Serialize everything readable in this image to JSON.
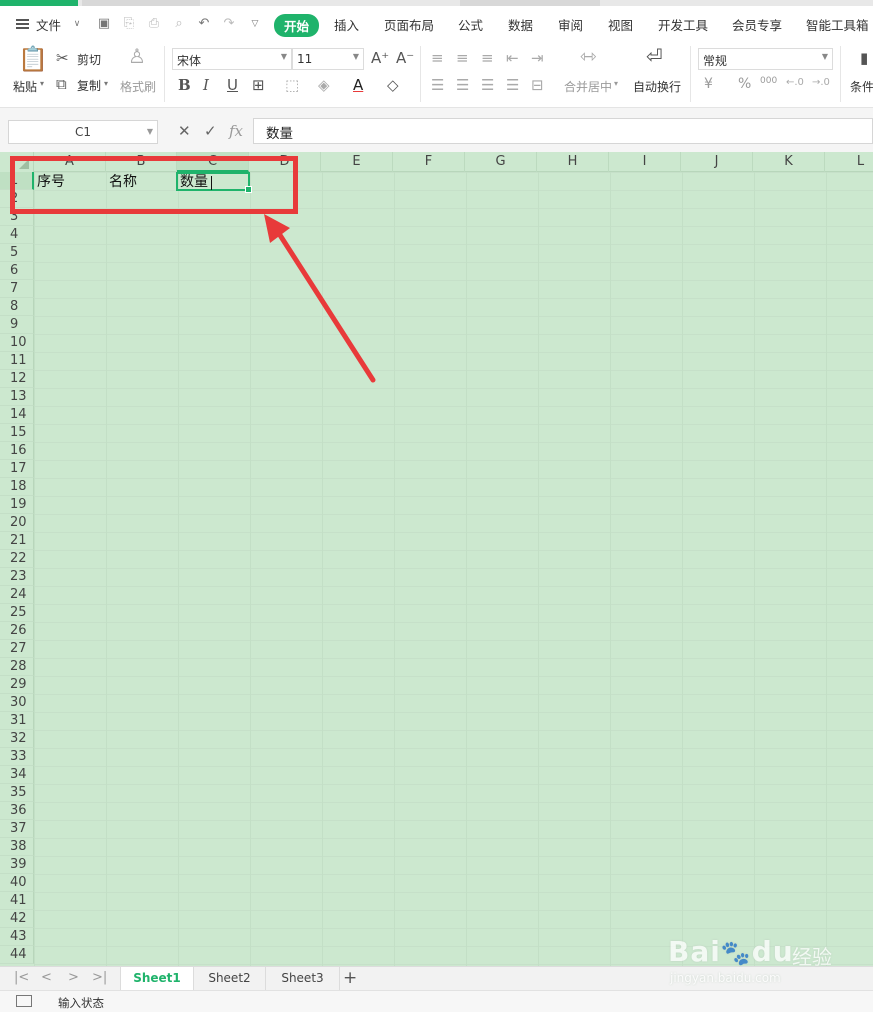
{
  "menu": {
    "file": "文件",
    "tabs": [
      "开始",
      "插入",
      "页面布局",
      "公式",
      "数据",
      "审阅",
      "视图",
      "开发工具",
      "会员专享",
      "智能工具箱"
    ]
  },
  "ribbon": {
    "paste": "粘贴",
    "cut": "剪切",
    "copy": "复制",
    "format_painter": "格式刷",
    "font_name": "宋体",
    "font_size": "11",
    "merge_center": "合并居中",
    "wrap_text": "自动换行",
    "number_format": "常规",
    "currency_symbol": "¥",
    "percent_symbol": "%",
    "thousands": "000",
    "conditional": "条件"
  },
  "formula_bar": {
    "name_box": "C1",
    "content": "数量",
    "fx": "fx"
  },
  "grid": {
    "columns": [
      "A",
      "B",
      "C",
      "D",
      "E",
      "F",
      "G",
      "H",
      "I",
      "J",
      "K",
      "L"
    ],
    "rows": [
      "1",
      "2",
      "3",
      "4",
      "5",
      "6",
      "7",
      "8",
      "9",
      "10",
      "11",
      "12",
      "13",
      "14",
      "15",
      "16",
      "17",
      "18",
      "19",
      "20",
      "21",
      "22",
      "23",
      "24",
      "25",
      "26",
      "27",
      "28",
      "29",
      "30",
      "31",
      "32",
      "33",
      "34",
      "35",
      "36",
      "37",
      "38",
      "39",
      "40",
      "41",
      "42",
      "43",
      "44"
    ],
    "cells": {
      "A1": "序号",
      "B1": "名称",
      "C1": "数量"
    },
    "active_cell": "C1",
    "background_color": "#cce8cf"
  },
  "sheets": [
    "Sheet1",
    "Sheet2",
    "Sheet3"
  ],
  "active_sheet": "Sheet1",
  "status": "输入状态",
  "watermark": {
    "brand": "Bai",
    "brand2": "du",
    "cn": "经验",
    "url": "jingyan.baidu.com"
  },
  "colors": {
    "accent": "#1fb36b",
    "annotation": "#e83a3a"
  }
}
